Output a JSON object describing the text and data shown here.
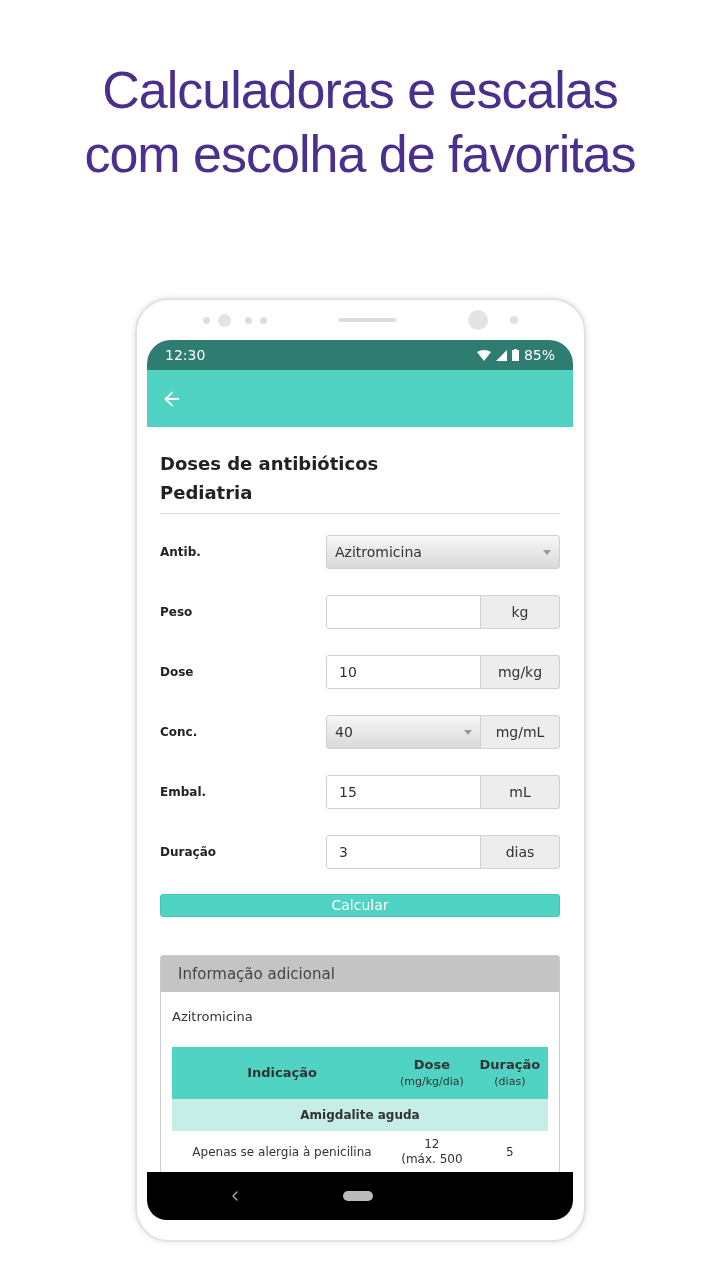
{
  "headline": [
    "Calculadoras e escalas",
    "com escolha de favoritas"
  ],
  "status_bar": {
    "time": "12:30",
    "battery": "85%"
  },
  "title": [
    "Doses de antibióticos",
    "Pediatria"
  ],
  "fields": [
    {
      "label": "Antib.",
      "kind": "select",
      "value": "Azitromicina"
    },
    {
      "label": "Peso",
      "kind": "unit",
      "unit": "kg"
    },
    {
      "label": "Dose",
      "kind": "unit",
      "value": "10",
      "unit": "mg/kg"
    },
    {
      "label": "Conc.",
      "kind": "select-unit",
      "value": "40",
      "unit": "mg/mL"
    },
    {
      "label": "Embal.",
      "kind": "unit",
      "value": "15",
      "unit": "mL"
    },
    {
      "label": "Duração",
      "kind": "unit",
      "value": "3",
      "unit": "dias"
    }
  ],
  "calculate_button": "Calcular",
  "info": {
    "header": "Informação adicional",
    "drug": "Azitromicina",
    "table": {
      "columns": [
        {
          "title": "Indicação"
        },
        {
          "title": "Dose",
          "sub": "(mg/kg/dia)"
        },
        {
          "title": "Duração",
          "sub": "(dias)"
        }
      ],
      "group": "Amigdalite aguda",
      "rows": [
        {
          "indication": "Apenas se alergia à penicilina",
          "dose": [
            "12",
            "(máx. 500"
          ],
          "duration": "5"
        }
      ]
    }
  }
}
